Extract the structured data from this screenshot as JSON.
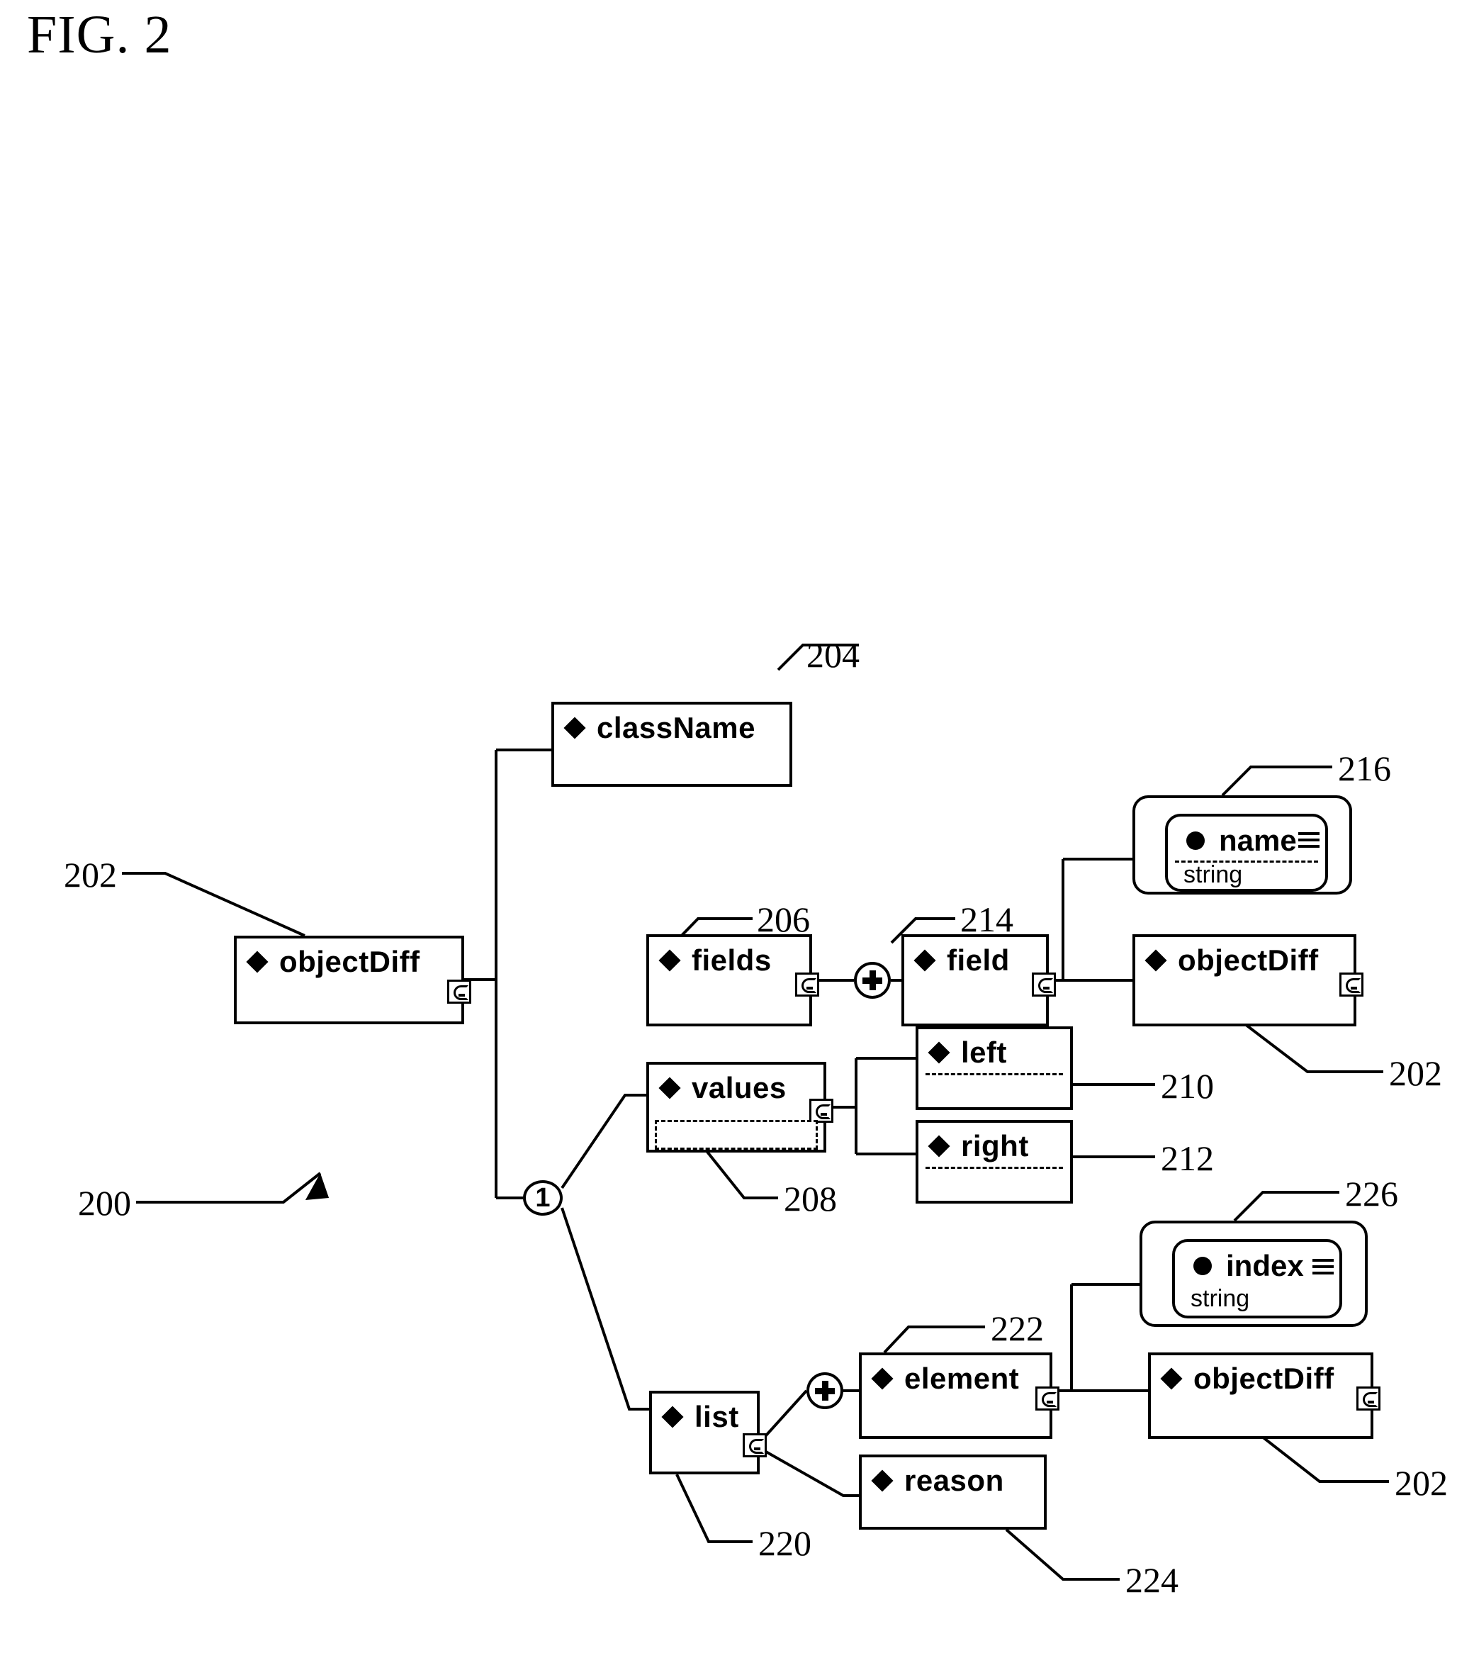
{
  "figure": {
    "title": "FIG. 2",
    "diagram_ref": "200"
  },
  "nodes": {
    "object_diff_root": {
      "label": "objectDiff",
      "ref": "202",
      "bullet": "diamond-icon",
      "badge": "tree-expand-icon"
    },
    "class_name": {
      "label": "className",
      "ref": "204",
      "bullet": "diamond-icon"
    },
    "fields": {
      "label": "fields",
      "ref": "206",
      "bullet": "diamond-icon",
      "badge": "tree-expand-icon"
    },
    "field": {
      "label": "field",
      "ref": "214",
      "bullet": "diamond-icon",
      "badge": "tree-expand-icon"
    },
    "name_attr": {
      "label": "name",
      "ref": "216",
      "bullet": "round-icon",
      "type": "string",
      "icon": "lines-icon"
    },
    "object_diff_right": {
      "label": "objectDiff",
      "ref": "202",
      "bullet": "diamond-icon",
      "badge": "tree-expand-icon"
    },
    "values": {
      "label": "values",
      "ref": "208",
      "bullet": "diamond-icon",
      "badge": "tree-expand-icon"
    },
    "left": {
      "label": "left",
      "ref": "210",
      "bullet": "diamond-icon"
    },
    "right": {
      "label": "right",
      "ref": "212",
      "bullet": "diamond-icon"
    },
    "list": {
      "label": "list",
      "ref": "220",
      "bullet": "diamond-icon",
      "badge": "tree-expand-icon"
    },
    "element": {
      "label": "element",
      "ref": "222",
      "bullet": "diamond-icon",
      "badge": "tree-expand-icon"
    },
    "reason": {
      "label": "reason",
      "ref": "224",
      "bullet": "diamond-icon"
    },
    "index_attr": {
      "label": "index",
      "ref": "226",
      "bullet": "round-icon",
      "type": "string",
      "icon": "lines-icon"
    },
    "object_diff_bottom": {
      "label": "objectDiff",
      "ref": "202",
      "bullet": "diamond-icon",
      "badge": "tree-expand-icon"
    }
  },
  "connectors": {
    "sequence_one": "1",
    "repeat_fields": "+",
    "repeat_list": "+"
  },
  "reference_numerals": [
    "200",
    "202",
    "204",
    "206",
    "208",
    "210",
    "212",
    "214",
    "216",
    "220",
    "222",
    "224",
    "226"
  ],
  "colors": {
    "ink": "#000000",
    "paper": "#ffffff"
  }
}
